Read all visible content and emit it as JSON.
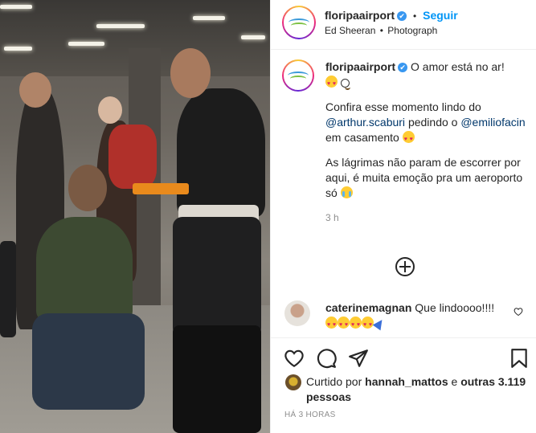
{
  "post": {
    "username": "floripaairport",
    "verified_mark": "✔",
    "separator": "•",
    "follow_label": "Seguir",
    "music": "Ed Sheeran",
    "dot": "•",
    "media_type": "Photograph"
  },
  "caption": {
    "username": "floripaairport",
    "verified_mark": "✔",
    "line1": "O amor está no ar!",
    "p2_start": "Confira esse momento lindo do",
    "mention1": "@arthur.scaburi",
    "p2_mid": "pedindo o",
    "mention2": "@emiliofacin",
    "p2_end": "em casamento",
    "p3": "As lágrimas não param de escorrer por aqui, é muita emoção pra um aeroporto só",
    "time": "3 h"
  },
  "comment": {
    "username": "caterinemagnan",
    "text": "Que lindoooo!!!!"
  },
  "likes": {
    "prefix": "Curtido por",
    "user": "hannah_mattos",
    "and": "e",
    "others": "outras 3.119 pessoas"
  },
  "posted": "HÁ 3 HORAS",
  "colors": {
    "accent": "#0095f6",
    "mention": "#00376b",
    "muted": "#8e8e8e"
  },
  "icons": [
    "heart-icon",
    "comment-icon",
    "share-icon",
    "bookmark-icon",
    "plus-circle-icon",
    "verified-icon"
  ]
}
